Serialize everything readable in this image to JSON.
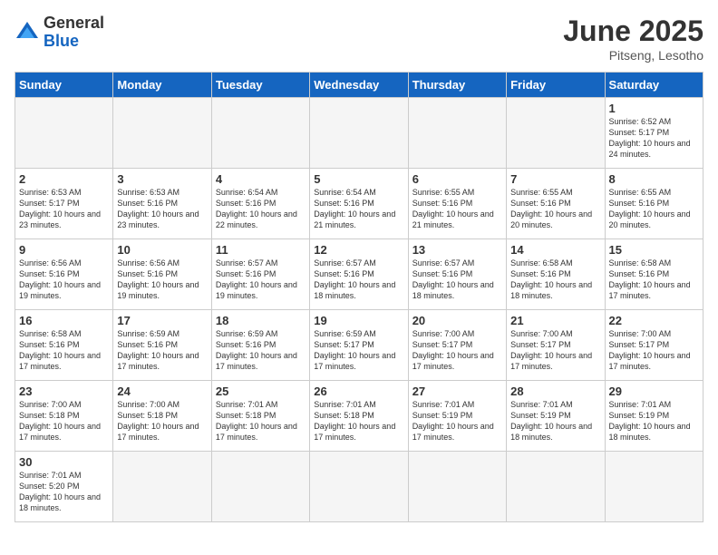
{
  "logo": {
    "general": "General",
    "blue": "Blue"
  },
  "title": "June 2025",
  "subtitle": "Pitseng, Lesotho",
  "headers": [
    "Sunday",
    "Monday",
    "Tuesday",
    "Wednesday",
    "Thursday",
    "Friday",
    "Saturday"
  ],
  "days": [
    {
      "num": "",
      "info": ""
    },
    {
      "num": "",
      "info": ""
    },
    {
      "num": "",
      "info": ""
    },
    {
      "num": "",
      "info": ""
    },
    {
      "num": "",
      "info": ""
    },
    {
      "num": "",
      "info": ""
    },
    {
      "num": "1",
      "info": "Sunrise: 6:52 AM\nSunset: 5:17 PM\nDaylight: 10 hours\nand 24 minutes."
    },
    {
      "num": "2",
      "info": "Sunrise: 6:53 AM\nSunset: 5:17 PM\nDaylight: 10 hours\nand 23 minutes."
    },
    {
      "num": "3",
      "info": "Sunrise: 6:53 AM\nSunset: 5:16 PM\nDaylight: 10 hours\nand 23 minutes."
    },
    {
      "num": "4",
      "info": "Sunrise: 6:54 AM\nSunset: 5:16 PM\nDaylight: 10 hours\nand 22 minutes."
    },
    {
      "num": "5",
      "info": "Sunrise: 6:54 AM\nSunset: 5:16 PM\nDaylight: 10 hours\nand 21 minutes."
    },
    {
      "num": "6",
      "info": "Sunrise: 6:55 AM\nSunset: 5:16 PM\nDaylight: 10 hours\nand 21 minutes."
    },
    {
      "num": "7",
      "info": "Sunrise: 6:55 AM\nSunset: 5:16 PM\nDaylight: 10 hours\nand 20 minutes."
    },
    {
      "num": "8",
      "info": "Sunrise: 6:55 AM\nSunset: 5:16 PM\nDaylight: 10 hours\nand 20 minutes."
    },
    {
      "num": "9",
      "info": "Sunrise: 6:56 AM\nSunset: 5:16 PM\nDaylight: 10 hours\nand 19 minutes."
    },
    {
      "num": "10",
      "info": "Sunrise: 6:56 AM\nSunset: 5:16 PM\nDaylight: 10 hours\nand 19 minutes."
    },
    {
      "num": "11",
      "info": "Sunrise: 6:57 AM\nSunset: 5:16 PM\nDaylight: 10 hours\nand 19 minutes."
    },
    {
      "num": "12",
      "info": "Sunrise: 6:57 AM\nSunset: 5:16 PM\nDaylight: 10 hours\nand 18 minutes."
    },
    {
      "num": "13",
      "info": "Sunrise: 6:57 AM\nSunset: 5:16 PM\nDaylight: 10 hours\nand 18 minutes."
    },
    {
      "num": "14",
      "info": "Sunrise: 6:58 AM\nSunset: 5:16 PM\nDaylight: 10 hours\nand 18 minutes."
    },
    {
      "num": "15",
      "info": "Sunrise: 6:58 AM\nSunset: 5:16 PM\nDaylight: 10 hours\nand 17 minutes."
    },
    {
      "num": "16",
      "info": "Sunrise: 6:58 AM\nSunset: 5:16 PM\nDaylight: 10 hours\nand 17 minutes."
    },
    {
      "num": "17",
      "info": "Sunrise: 6:59 AM\nSunset: 5:16 PM\nDaylight: 10 hours\nand 17 minutes."
    },
    {
      "num": "18",
      "info": "Sunrise: 6:59 AM\nSunset: 5:16 PM\nDaylight: 10 hours\nand 17 minutes."
    },
    {
      "num": "19",
      "info": "Sunrise: 6:59 AM\nSunset: 5:17 PM\nDaylight: 10 hours\nand 17 minutes."
    },
    {
      "num": "20",
      "info": "Sunrise: 7:00 AM\nSunset: 5:17 PM\nDaylight: 10 hours\nand 17 minutes."
    },
    {
      "num": "21",
      "info": "Sunrise: 7:00 AM\nSunset: 5:17 PM\nDaylight: 10 hours\nand 17 minutes."
    },
    {
      "num": "22",
      "info": "Sunrise: 7:00 AM\nSunset: 5:17 PM\nDaylight: 10 hours\nand 17 minutes."
    },
    {
      "num": "23",
      "info": "Sunrise: 7:00 AM\nSunset: 5:18 PM\nDaylight: 10 hours\nand 17 minutes."
    },
    {
      "num": "24",
      "info": "Sunrise: 7:00 AM\nSunset: 5:18 PM\nDaylight: 10 hours\nand 17 minutes."
    },
    {
      "num": "25",
      "info": "Sunrise: 7:01 AM\nSunset: 5:18 PM\nDaylight: 10 hours\nand 17 minutes."
    },
    {
      "num": "26",
      "info": "Sunrise: 7:01 AM\nSunset: 5:18 PM\nDaylight: 10 hours\nand 17 minutes."
    },
    {
      "num": "27",
      "info": "Sunrise: 7:01 AM\nSunset: 5:19 PM\nDaylight: 10 hours\nand 17 minutes."
    },
    {
      "num": "28",
      "info": "Sunrise: 7:01 AM\nSunset: 5:19 PM\nDaylight: 10 hours\nand 18 minutes."
    },
    {
      "num": "29",
      "info": "Sunrise: 7:01 AM\nSunset: 5:19 PM\nDaylight: 10 hours\nand 18 minutes."
    },
    {
      "num": "30",
      "info": "Sunrise: 7:01 AM\nSunset: 5:20 PM\nDaylight: 10 hours\nand 18 minutes."
    },
    {
      "num": "",
      "info": ""
    },
    {
      "num": "",
      "info": ""
    },
    {
      "num": "",
      "info": ""
    },
    {
      "num": "",
      "info": ""
    },
    {
      "num": "",
      "info": ""
    }
  ]
}
